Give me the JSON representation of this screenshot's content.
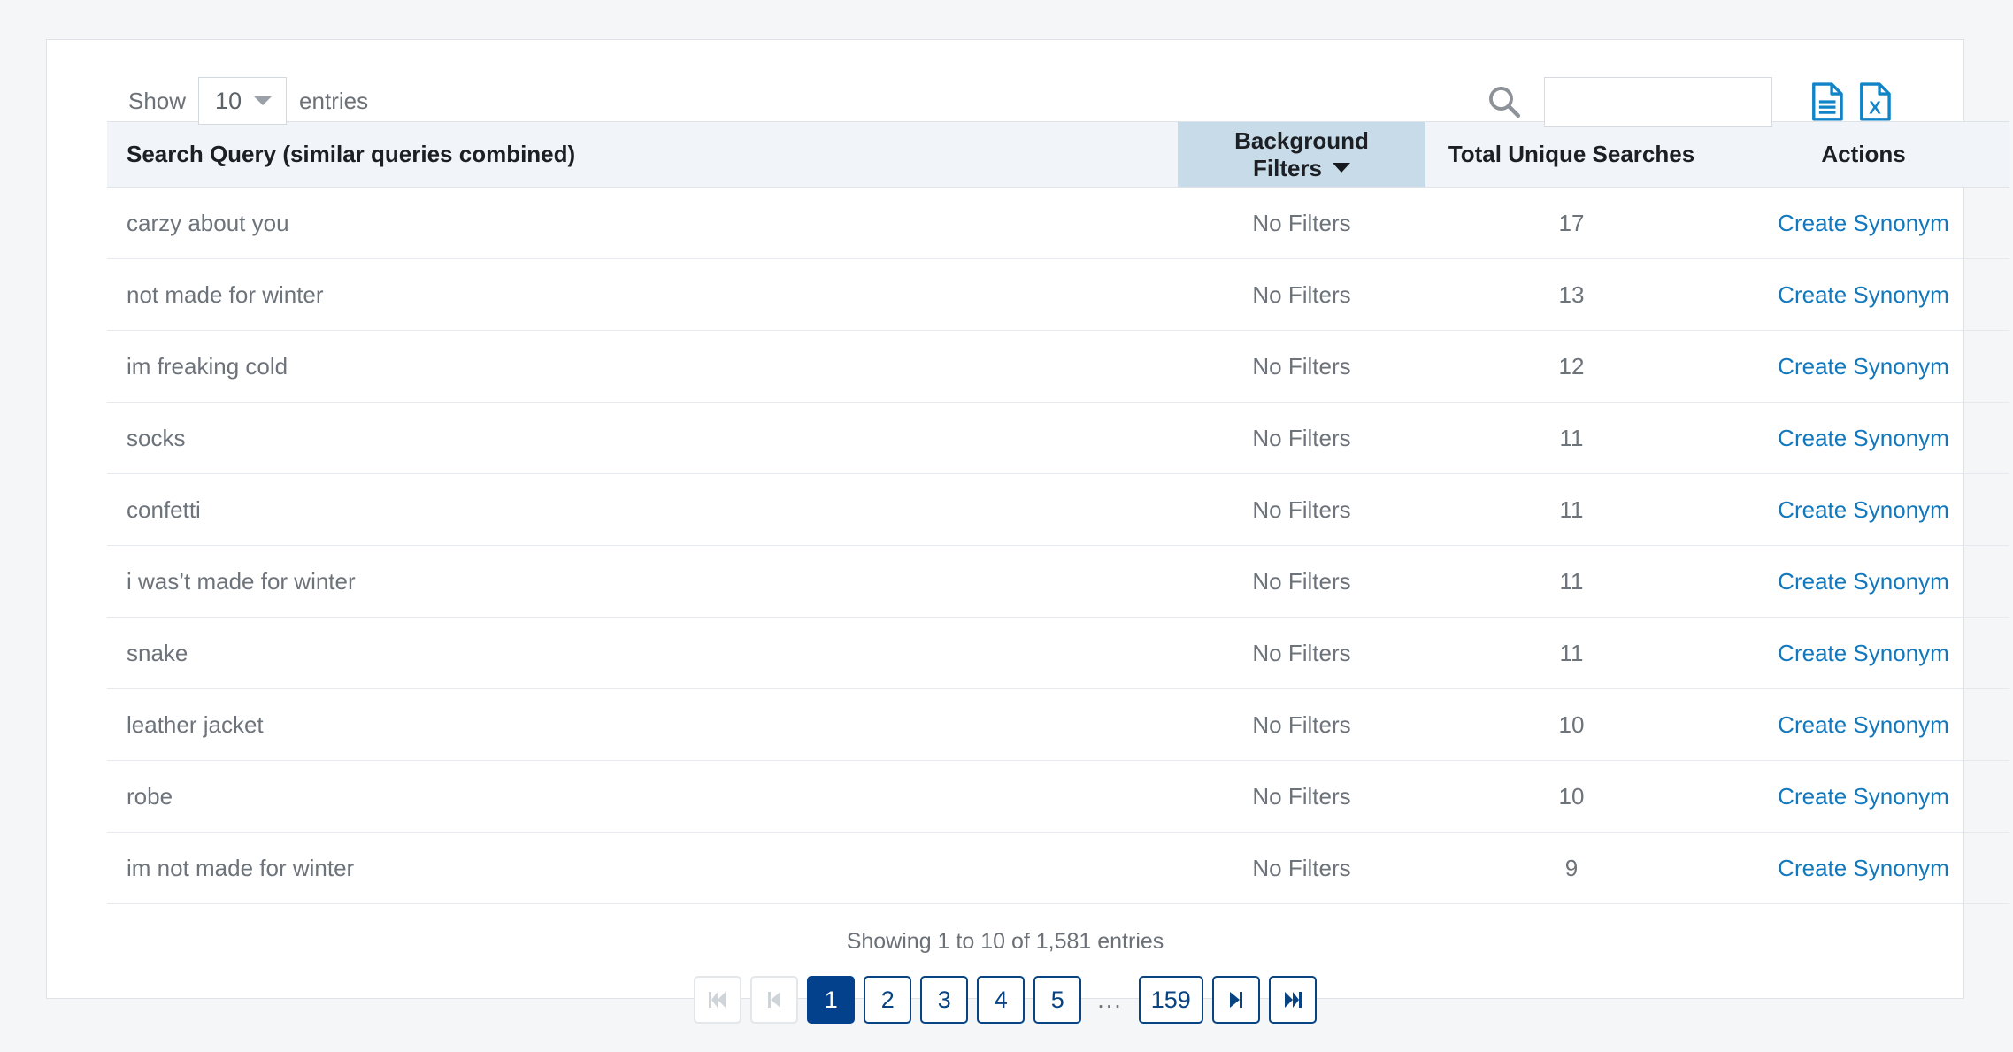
{
  "toolbar": {
    "length_label": "Show",
    "length_value": "10",
    "length_suffix": "entries",
    "search_value": "",
    "search_placeholder": "",
    "search_icon": "search-icon",
    "export_csv_icon": "document-export-icon",
    "export_excel_icon": "excel-export-icon"
  },
  "table": {
    "columns": [
      {
        "label": "Search Query (similar queries combined)",
        "key": "query",
        "align": "left",
        "sorted": false
      },
      {
        "label": "Background Filters",
        "key": "filters",
        "align": "center",
        "sorted": true,
        "sort_direction": "desc"
      },
      {
        "label": "Total Unique Searches",
        "key": "total",
        "align": "center",
        "sorted": false
      },
      {
        "label": "Actions",
        "key": "actions",
        "align": "center",
        "sorted": false
      }
    ],
    "rows": [
      {
        "query": "carzy about you",
        "filters": "No Filters",
        "total": "17",
        "action": "Create Synonym"
      },
      {
        "query": "not made for winter",
        "filters": "No Filters",
        "total": "13",
        "action": "Create Synonym"
      },
      {
        "query": "im freaking cold",
        "filters": "No Filters",
        "total": "12",
        "action": "Create Synonym"
      },
      {
        "query": "socks",
        "filters": "No Filters",
        "total": "11",
        "action": "Create Synonym"
      },
      {
        "query": "confetti",
        "filters": "No Filters",
        "total": "11",
        "action": "Create Synonym"
      },
      {
        "query": "i was’t made for winter",
        "filters": "No Filters",
        "total": "11",
        "action": "Create Synonym"
      },
      {
        "query": "snake",
        "filters": "No Filters",
        "total": "11",
        "action": "Create Synonym"
      },
      {
        "query": "leather jacket",
        "filters": "No Filters",
        "total": "10",
        "action": "Create Synonym"
      },
      {
        "query": "robe",
        "filters": "No Filters",
        "total": "10",
        "action": "Create Synonym"
      },
      {
        "query": "im not made for winter",
        "filters": "No Filters",
        "total": "9",
        "action": "Create Synonym"
      }
    ]
  },
  "footer": {
    "info": "Showing 1 to 10 of 1,581 entries",
    "pagination": {
      "first_label": "first-page-icon",
      "prev_label": "previous-page-icon",
      "pages": [
        "1",
        "2",
        "3",
        "4",
        "5"
      ],
      "ellipsis": "...",
      "last_page": "159",
      "next_label": "next-page-icon",
      "last_label": "last-page-icon",
      "active_page": "1"
    }
  },
  "colors": {
    "page_background": "#f5f6f8",
    "card_background": "#ffffff",
    "header_background": "#f1f4f8",
    "sorted_header_background": "#c8dbe9",
    "link_blue": "#1278be",
    "pagination_navy": "#04418c",
    "text_grey": "#6d737a"
  }
}
